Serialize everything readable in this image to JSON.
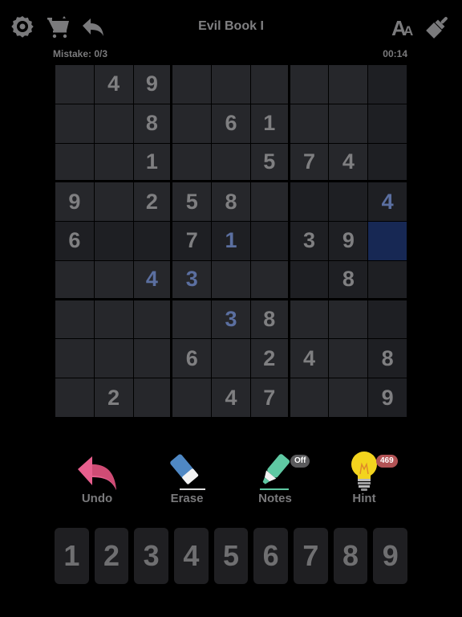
{
  "header": {
    "title": "Evil Book I",
    "mistake_label": "Mistake: 0/3",
    "timer": "00:14",
    "icons": [
      "gear-icon",
      "cart-icon",
      "back-arrow-icon",
      "font-size-icon",
      "paintbrush-icon"
    ]
  },
  "board": {
    "selected": {
      "row": 5,
      "col": 9
    },
    "rows": [
      [
        0,
        4,
        9,
        0,
        0,
        0,
        0,
        0,
        0
      ],
      [
        0,
        0,
        8,
        0,
        6,
        1,
        0,
        0,
        0
      ],
      [
        0,
        0,
        1,
        0,
        0,
        5,
        7,
        4,
        0
      ],
      [
        9,
        0,
        2,
        5,
        8,
        0,
        0,
        0,
        4
      ],
      [
        6,
        0,
        0,
        7,
        1,
        0,
        3,
        9,
        0
      ],
      [
        0,
        0,
        4,
        3,
        0,
        0,
        0,
        8,
        0
      ],
      [
        0,
        0,
        0,
        0,
        3,
        8,
        0,
        0,
        0
      ],
      [
        0,
        0,
        0,
        6,
        0,
        2,
        4,
        0,
        8
      ],
      [
        0,
        2,
        0,
        0,
        4,
        7,
        0,
        0,
        9
      ]
    ],
    "user_entered": [
      [
        4,
        9
      ],
      [
        5,
        5
      ],
      [
        6,
        3
      ],
      [
        6,
        4
      ],
      [
        7,
        5
      ]
    ],
    "colors": {
      "cell": "#26272b",
      "highlight": "#1e1f23",
      "selected": "#172854",
      "given_digit": "#7f7f81",
      "user_digit": "#5b6fa0"
    }
  },
  "tools": {
    "undo": {
      "label": "Undo",
      "icon": "undo-arrow-icon"
    },
    "erase": {
      "label": "Erase",
      "icon": "eraser-icon"
    },
    "notes": {
      "label": "Notes",
      "icon": "highlighter-icon",
      "state": "Off"
    },
    "hint": {
      "label": "Hint",
      "icon": "lightbulb-icon",
      "count": "469"
    }
  },
  "numpad": [
    "1",
    "2",
    "3",
    "4",
    "5",
    "6",
    "7",
    "8",
    "9"
  ]
}
